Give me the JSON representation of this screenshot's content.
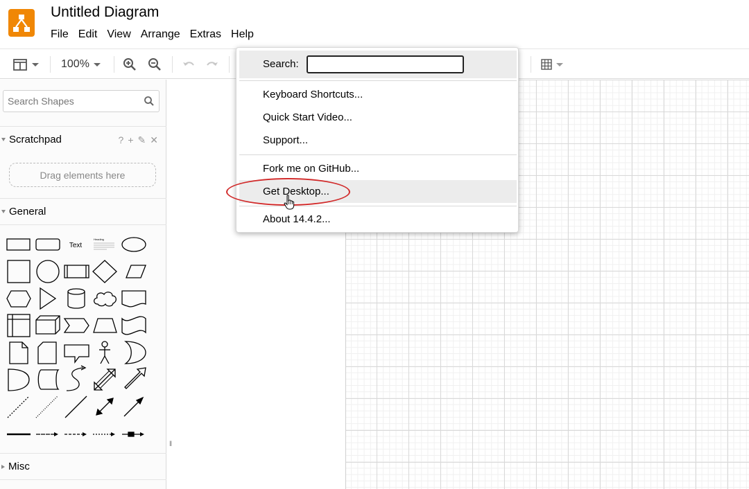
{
  "document": {
    "title": "Untitled Diagram"
  },
  "menubar": [
    "File",
    "Edit",
    "View",
    "Arrange",
    "Extras",
    "Help"
  ],
  "toolbar": {
    "zoom": "100%"
  },
  "sidebar": {
    "search_placeholder": "Search Shapes",
    "scratchpad": {
      "label": "Scratchpad",
      "tools": [
        "?",
        "+",
        "✎",
        "✕"
      ],
      "drop_hint": "Drag elements here"
    },
    "sections": {
      "general": "General",
      "misc": "Misc"
    },
    "shape_text": "Text",
    "shape_heading": "Heading"
  },
  "help_menu": {
    "search_label": "Search:",
    "search_value": "",
    "groups": [
      [
        "Keyboard Shortcuts...",
        "Quick Start Video...",
        "Support..."
      ],
      [
        "Fork me on GitHub...",
        "Get Desktop..."
      ],
      [
        "About 14.4.2..."
      ]
    ],
    "hovered_item": "Get Desktop..."
  },
  "colors": {
    "brand": "#f08705",
    "annotation": "#d12a2a",
    "menu_hover": "#ececec"
  }
}
